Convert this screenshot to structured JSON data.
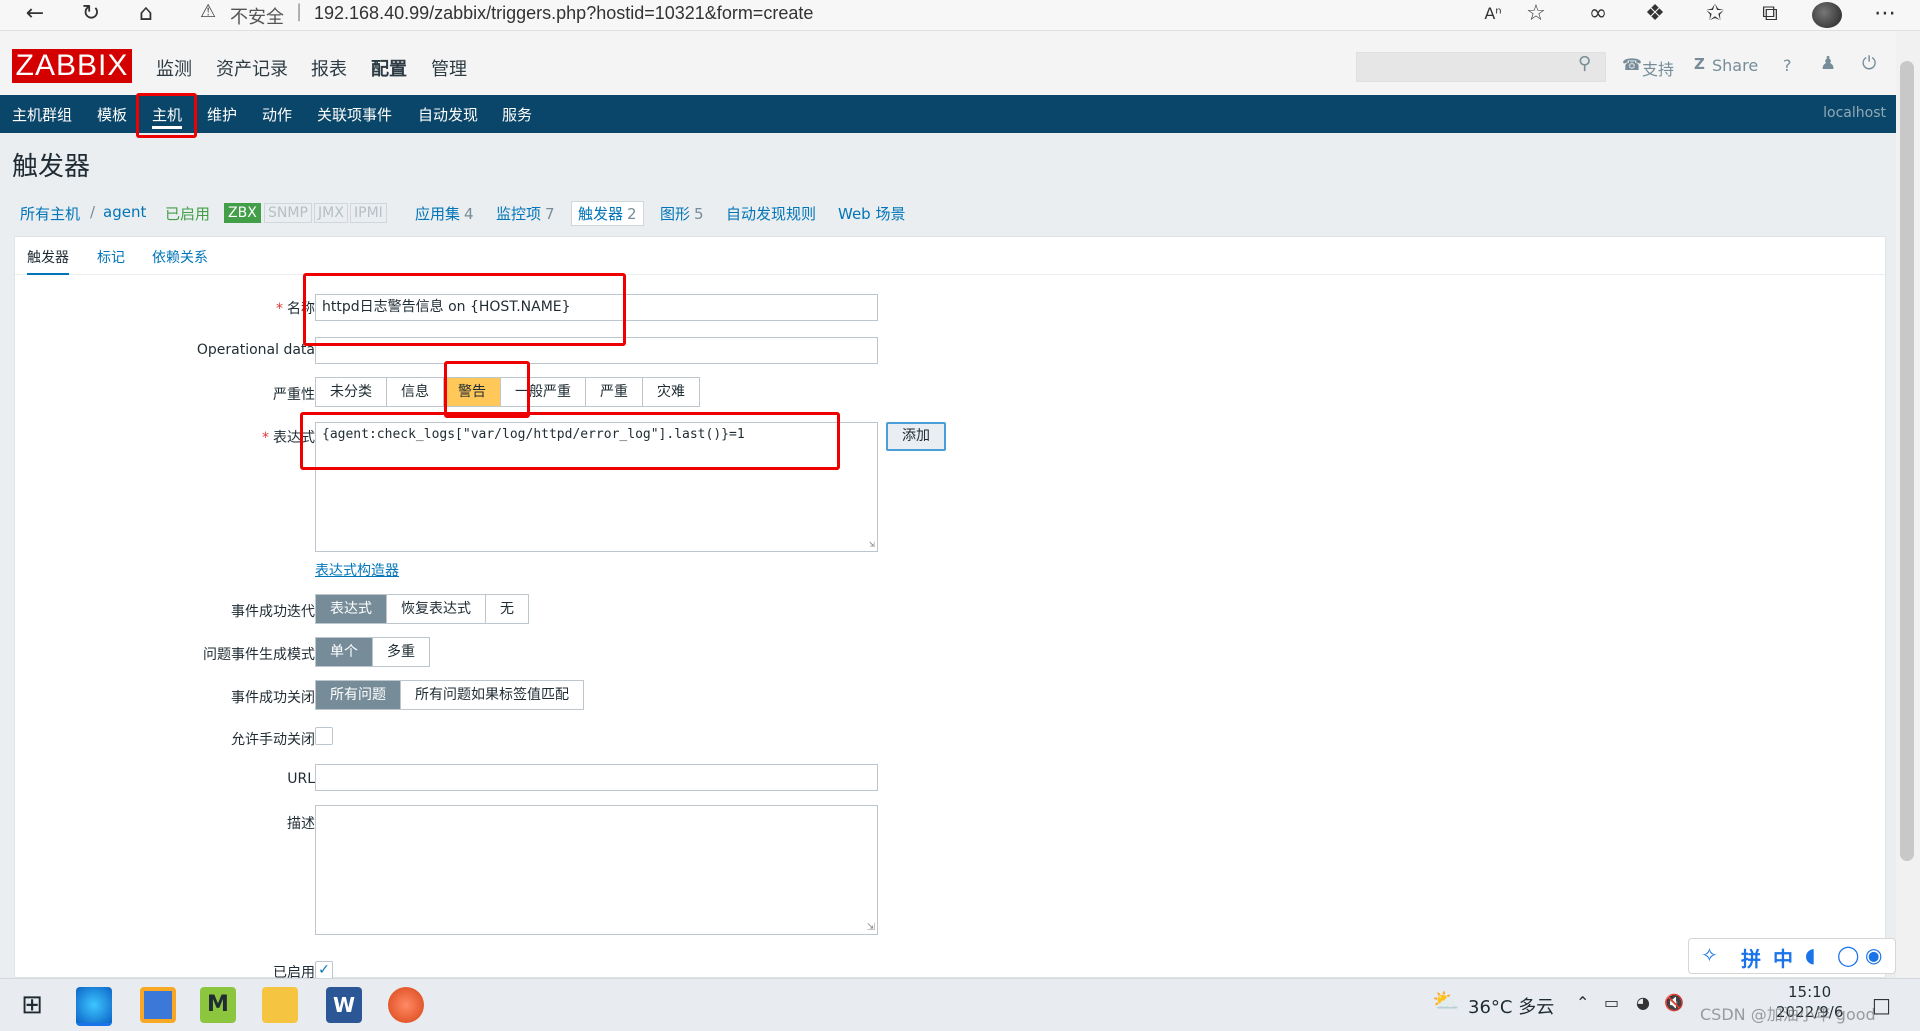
{
  "browser": {
    "insecure_label": "不安全",
    "separator": "|",
    "url": "192.168.40.99/zabbix/triggers.php?hostid=10321&form=create"
  },
  "header": {
    "logo": "ZABBIX",
    "menu": [
      "监测",
      "资产记录",
      "报表",
      "配置",
      "管理"
    ],
    "support_label": "支持",
    "share_label": "Share",
    "help_label": "?"
  },
  "subnav": {
    "items": [
      "主机群组",
      "模板",
      "主机",
      "维护",
      "动作",
      "关联项事件",
      "自动发现",
      "服务"
    ],
    "active": "主机",
    "server": "localhost"
  },
  "page": {
    "title": "触发器"
  },
  "breadcrumbs": {
    "all_hosts": "所有主机",
    "separator": "/",
    "host": "agent",
    "status": "已启用",
    "badges": [
      "ZBX",
      "SNMP",
      "JMX",
      "IPMI"
    ],
    "apps": {
      "label": "应用集",
      "count": "4"
    },
    "items": {
      "label": "监控项",
      "count": "7"
    },
    "triggers": {
      "label": "触发器",
      "count": "2"
    },
    "graphs": {
      "label": "图形",
      "count": "5"
    },
    "discovery": "自动发现规则",
    "web": "Web 场景"
  },
  "tabs": [
    "触发器",
    "标记",
    "依赖关系"
  ],
  "form": {
    "name": {
      "label": "名称",
      "value": "httpd日志警告信息 on {HOST.NAME}"
    },
    "opdata": {
      "label": "Operational data",
      "value": ""
    },
    "severity": {
      "label": "严重性",
      "options": [
        "未分类",
        "信息",
        "警告",
        "一般严重",
        "严重",
        "灾难"
      ],
      "selected": "警告"
    },
    "expression": {
      "label": "表达式",
      "value": "{agent:check_logs[\"var/log/httpd/error_log\"].last()}=1",
      "add_button": "添加",
      "builder_link": "表达式构造器"
    },
    "ok_event_gen": {
      "label": "事件成功迭代",
      "options": [
        "表达式",
        "恢复表达式",
        "无"
      ],
      "selected": "表达式"
    },
    "problem_mode": {
      "label": "问题事件生成模式",
      "options": [
        "单个",
        "多重"
      ],
      "selected": "单个"
    },
    "ok_close": {
      "label": "事件成功关闭",
      "options": [
        "所有问题",
        "所有问题如果标签值匹配"
      ],
      "selected": "所有问题"
    },
    "manual_close": {
      "label": "允许手动关闭",
      "checked": false
    },
    "url": {
      "label": "URL",
      "value": ""
    },
    "description": {
      "label": "描述",
      "value": ""
    },
    "enabled": {
      "label": "已启用",
      "checked": true
    }
  },
  "ime": [
    "拼",
    "中"
  ],
  "taskbar": {
    "weather": "36°C 多云",
    "time": "15:10",
    "date": "2022/9/6",
    "watermark": "CSDN @加油小年 good"
  },
  "colors": {
    "brand": "#d40000",
    "subnav": "#0a466a",
    "link": "#0275b8",
    "warning_severity": "#ffc859",
    "annotation": "#e00000"
  }
}
